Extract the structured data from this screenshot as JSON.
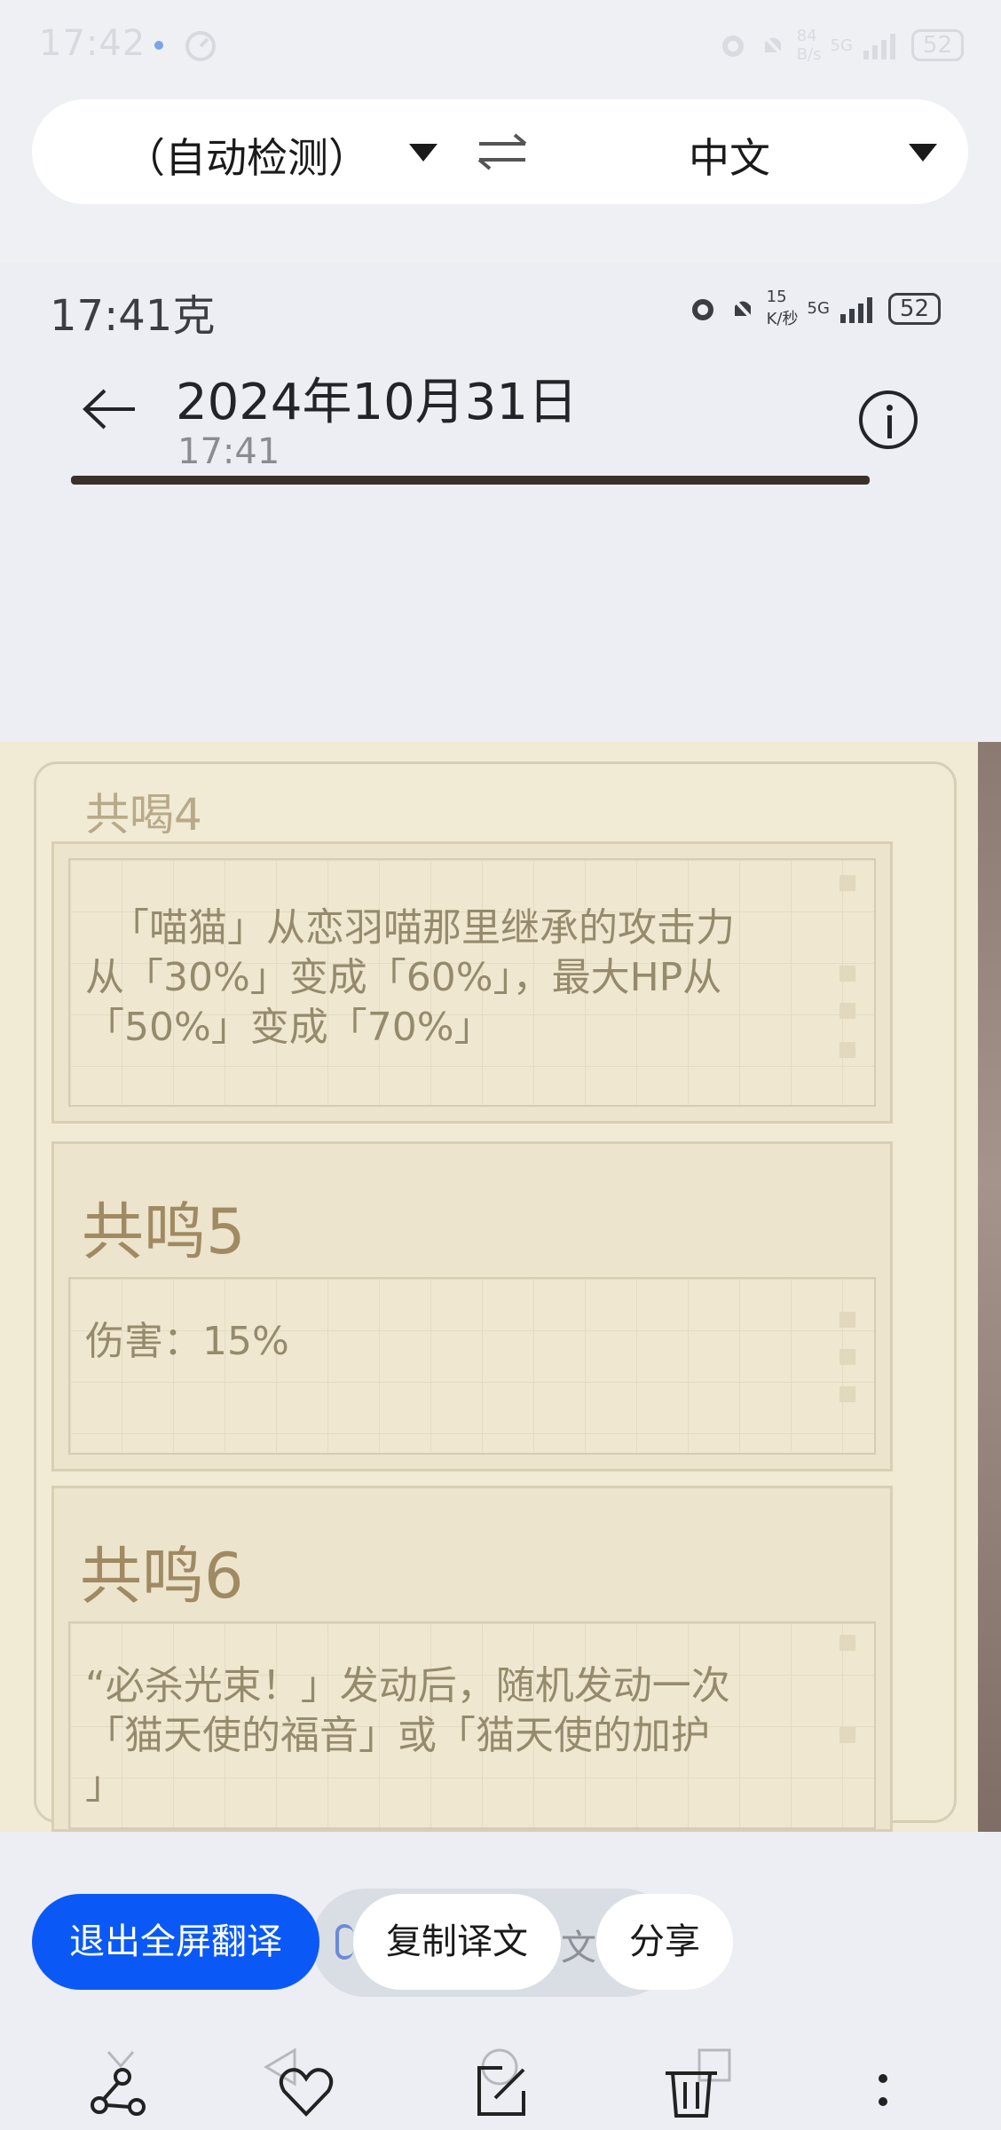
{
  "system_status": {
    "time": "17:42",
    "battery": "52",
    "speed": "84",
    "speed_unit": "B/s",
    "network": "5G"
  },
  "translate_bar": {
    "source_language": "（自动检测）",
    "target_language": "中文",
    "swap_icon": "swap-arrows-icon",
    "dropdown_icon": "triangle-down-icon"
  },
  "photo_header": {
    "status_time": "17:41克",
    "status_speed": "15",
    "status_speed_unit": "K/秒",
    "status_network": "5G",
    "status_battery": "52",
    "date": "2024年10月31日",
    "time": "17:41"
  },
  "panels": [
    {
      "heading": "共喝4",
      "body": "  「喵猫」从恋羽喵那里继承的攻击力\n从「30%」变成「60%」，最大HP从\n「50%」变成「70%」"
    },
    {
      "heading": "共鸣5",
      "body": "伤害：15%"
    },
    {
      "heading": "共鸣6",
      "body": "“必杀光束！」发动后，随机发动一次\n「猫天使的福音」或「猫天使的加护\n」"
    }
  ],
  "actions": {
    "exit_fullscreen": "退出全屏翻译",
    "copy_translation": "复制译文",
    "peek_text": "文字",
    "share": "分享"
  },
  "colors": {
    "accent": "#0a59f7",
    "parchment": "#f1ead5",
    "heading": "#a08a62"
  }
}
